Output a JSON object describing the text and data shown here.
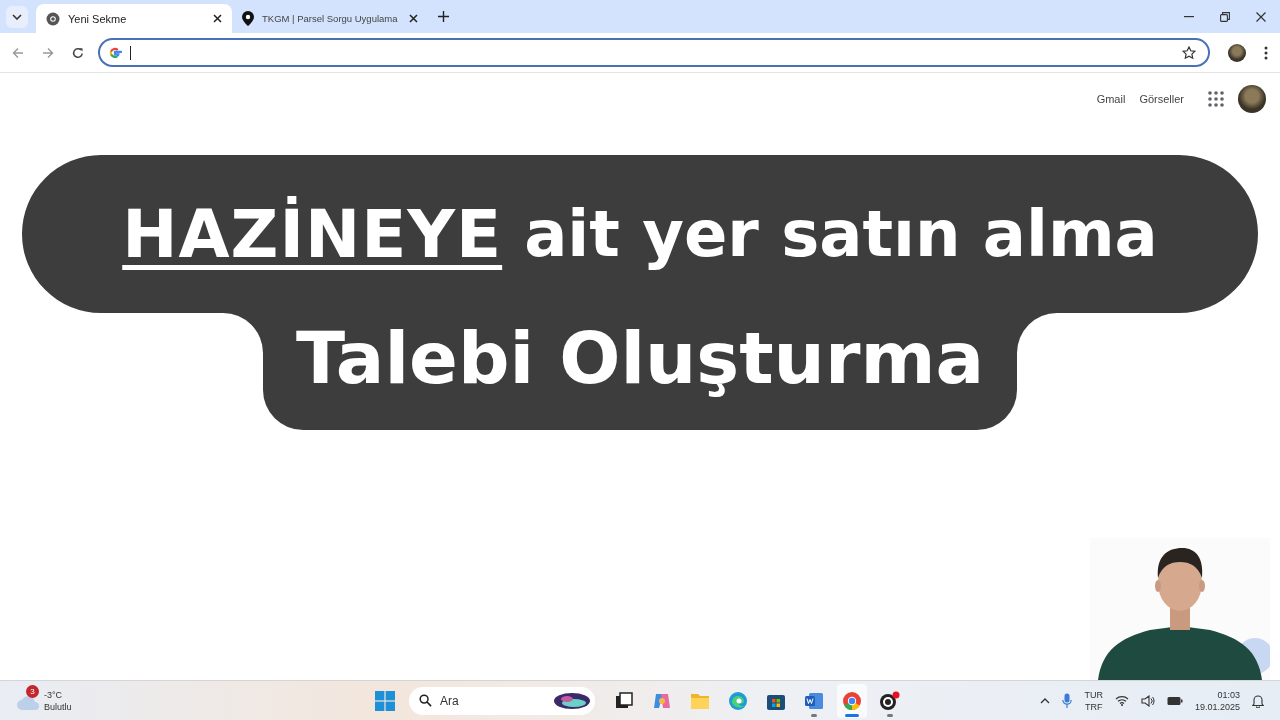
{
  "tabs": [
    {
      "title": "Yeni Sekme",
      "kind": "chrome",
      "selected": true
    },
    {
      "title": "TKGM | Parsel Sorgu Uygulama",
      "kind": "pin",
      "selected": false
    }
  ],
  "top_links": [
    "Gmail",
    "Görseller"
  ],
  "banner": {
    "highlight": "HAZİNEYE",
    "line1": "ait yer satın alma",
    "line2": "Talebi Oluşturma"
  },
  "taskbar": {
    "weather": {
      "badge": "3",
      "temperature": "-3°C",
      "condition": "Bulutlu"
    },
    "search": {
      "placeholder": "Ara"
    },
    "apps": [
      {
        "kind": "taskview",
        "running": false,
        "selected": false
      },
      {
        "kind": "copilot",
        "running": false,
        "selected": false
      },
      {
        "kind": "explorer",
        "running": false,
        "selected": false
      },
      {
        "kind": "edge",
        "running": false,
        "selected": false
      },
      {
        "kind": "store",
        "running": false,
        "selected": false
      },
      {
        "kind": "word",
        "running": true,
        "selected": false
      },
      {
        "kind": "chrome",
        "running": true,
        "selected": true
      },
      {
        "kind": "obs",
        "running": true,
        "selected": false
      }
    ],
    "tray": {
      "language": "TUR",
      "layout": "TRF",
      "time": "01:03",
      "date": "19.01.2025"
    }
  }
}
